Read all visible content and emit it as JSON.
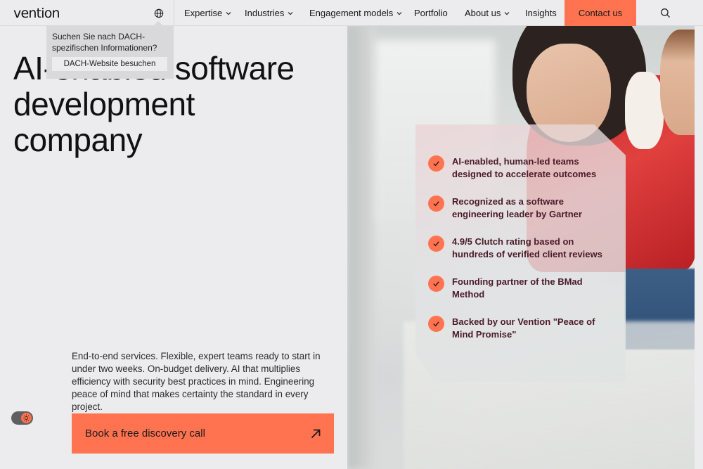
{
  "header": {
    "logo": "vention",
    "nav": [
      {
        "label": "Expertise",
        "dropdown": true
      },
      {
        "label": "Industries",
        "dropdown": true
      },
      {
        "label": "Engagement models",
        "dropdown": true
      },
      {
        "label": "Portfolio",
        "dropdown": false
      },
      {
        "label": "About us",
        "dropdown": true
      },
      {
        "label": "Insights",
        "dropdown": false
      }
    ],
    "contact_label": "Contact us",
    "icons": {
      "globe": "globe-icon",
      "search": "search-icon",
      "chevron": "chevron-down-icon"
    }
  },
  "popover": {
    "text": "Suchen Sie nach DACH-spezifischen Informationen?",
    "button_label": "DACH-Website besuchen"
  },
  "hero": {
    "title_lines": [
      "AI-enabled software",
      "development",
      "company"
    ],
    "description": "End-to-end services. Flexible, expert teams ready to start in under two weeks. On-budget delivery. AI that multiplies efficiency with security best practices in mind. Engineering peace of mind that makes certainty the standard in every project.",
    "cta_label": "Book a free discovery call"
  },
  "features": [
    "AI-enabled, human-led teams designed to accelerate outcomes",
    "Recognized as a software engineering leader by Gartner",
    "4.9/5 Clutch rating based on hundreds of verified client reviews",
    "Founding partner of the BMad Method",
    "Backed by our Vention \"Peace of Mind Promise\""
  ],
  "colors": {
    "accent": "#ff7350",
    "background": "#ececee",
    "feature_text": "#4a1a28"
  }
}
